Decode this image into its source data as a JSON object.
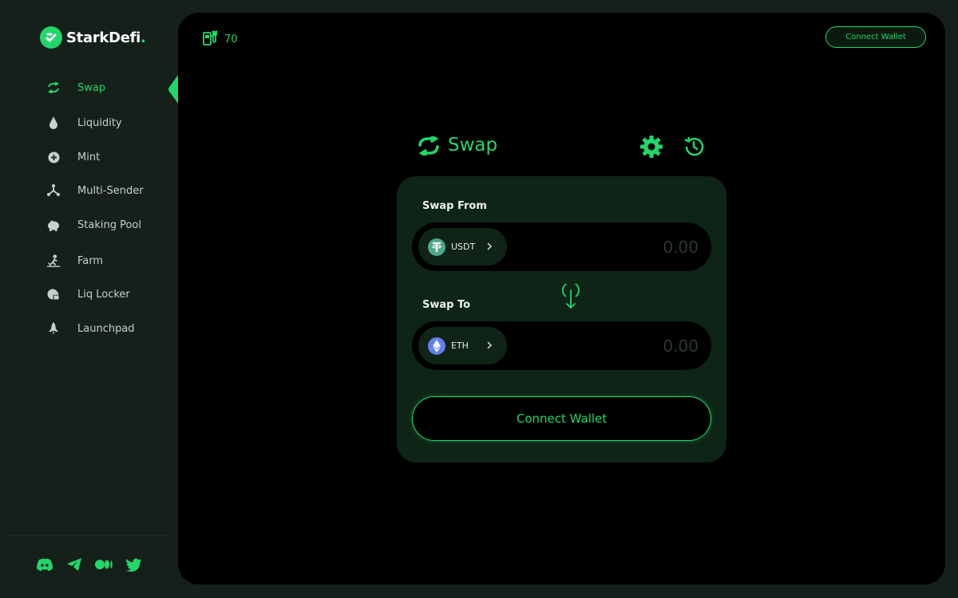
{
  "brand": {
    "name": "StarkDefi",
    "dot": "."
  },
  "nav": {
    "items": [
      {
        "label": "Swap",
        "icon": "swap-icon",
        "active": true
      },
      {
        "label": "Liquidity",
        "icon": "droplet-icon",
        "active": false
      },
      {
        "label": "Mint",
        "icon": "plus-circle-icon",
        "active": false
      },
      {
        "label": "Multi-Sender",
        "icon": "network-icon",
        "active": false
      },
      {
        "label": "Staking Pool",
        "icon": "piggy-bank-icon",
        "active": false
      },
      {
        "label": "Farm",
        "icon": "farmer-icon",
        "active": false
      },
      {
        "label": "Liq Locker",
        "icon": "lock-icon",
        "active": false
      },
      {
        "label": "Launchpad",
        "icon": "rocket-icon",
        "active": false
      }
    ]
  },
  "socials": [
    "discord-icon",
    "telegram-icon",
    "medium-icon",
    "twitter-icon"
  ],
  "header": {
    "points": "70",
    "points_icon": "fuel-pump-icon",
    "connect_label": "Connect Wallet"
  },
  "swap": {
    "title": "Swap",
    "from_label": "Swap From",
    "to_label": "Swap To",
    "from_token": "USDT",
    "to_token": "ETH",
    "from_amount_placeholder": "0.00",
    "to_amount_placeholder": "0.00",
    "connect_label": "Connect Wallet"
  },
  "colors": {
    "accent": "#22d66a",
    "background": "#15201a",
    "panel": "#000000",
    "card": "#0e2416",
    "usdt": "#4fa98c",
    "eth": "#627eea"
  }
}
